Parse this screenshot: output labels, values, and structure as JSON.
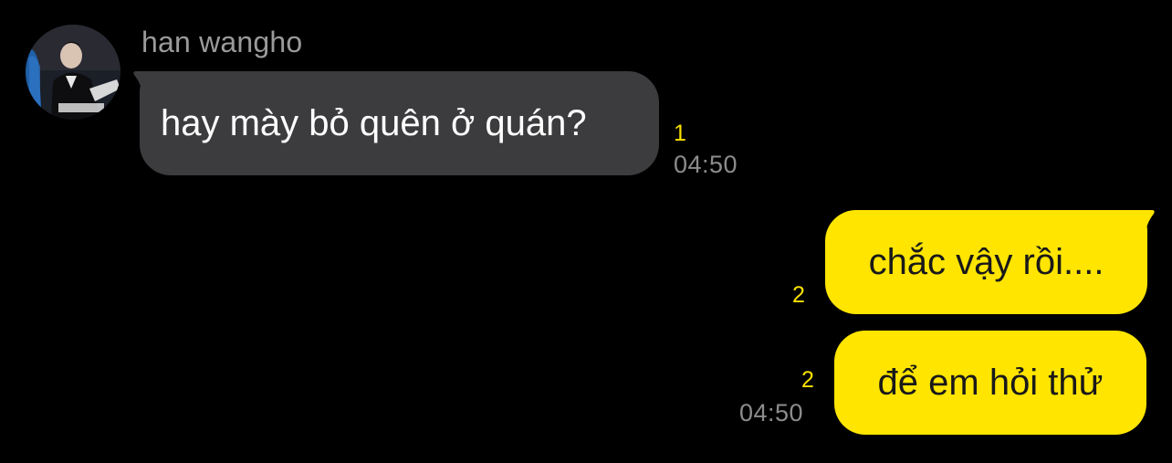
{
  "incoming": {
    "sender_name": "han wangho",
    "message": "hay mày bỏ quên ở quán?",
    "unread_count": "1",
    "time": "04:50"
  },
  "outgoing": [
    {
      "message": "chắc vậy rồi....",
      "unread_count": "2"
    },
    {
      "message": "để em hỏi thử",
      "unread_count": "2",
      "time": "04:50"
    }
  ],
  "colors": {
    "background": "#000000",
    "incoming_bubble": "#3c3c3e",
    "outgoing_bubble": "#ffe500",
    "unread": "#f9e000",
    "timestamp": "#8c8c8c"
  },
  "icons": {
    "avatar": "profile-photo"
  }
}
